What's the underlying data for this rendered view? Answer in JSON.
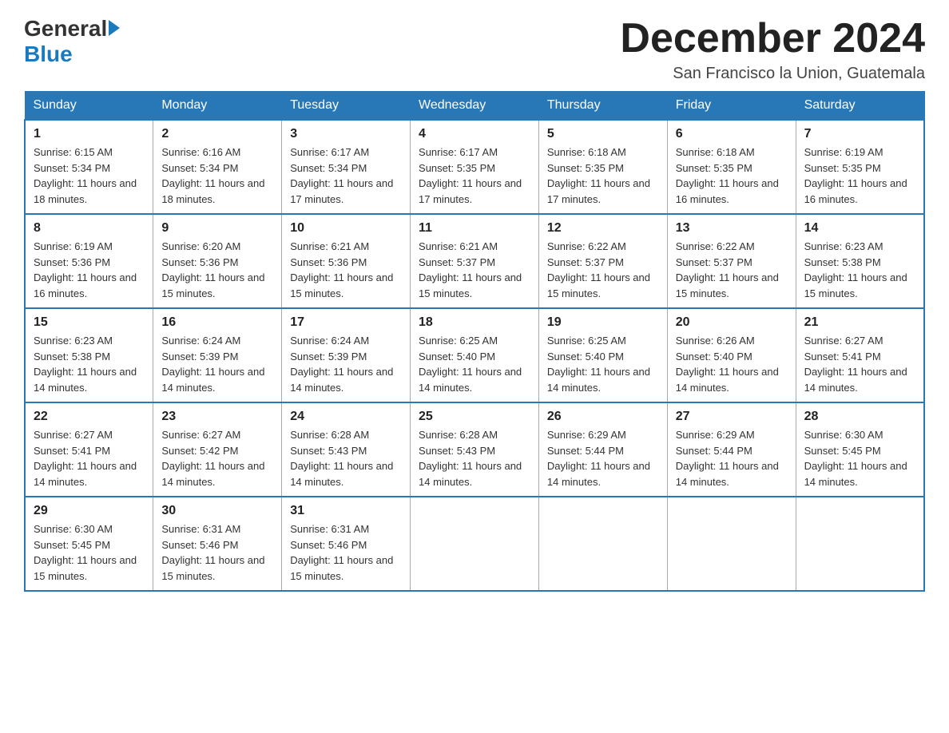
{
  "logo": {
    "general": "General",
    "blue": "Blue"
  },
  "title": "December 2024",
  "location": "San Francisco la Union, Guatemala",
  "weekdays": [
    "Sunday",
    "Monday",
    "Tuesday",
    "Wednesday",
    "Thursday",
    "Friday",
    "Saturday"
  ],
  "weeks": [
    [
      {
        "day": "1",
        "sunrise": "6:15 AM",
        "sunset": "5:34 PM",
        "daylight": "11 hours and 18 minutes."
      },
      {
        "day": "2",
        "sunrise": "6:16 AM",
        "sunset": "5:34 PM",
        "daylight": "11 hours and 18 minutes."
      },
      {
        "day": "3",
        "sunrise": "6:17 AM",
        "sunset": "5:34 PM",
        "daylight": "11 hours and 17 minutes."
      },
      {
        "day": "4",
        "sunrise": "6:17 AM",
        "sunset": "5:35 PM",
        "daylight": "11 hours and 17 minutes."
      },
      {
        "day": "5",
        "sunrise": "6:18 AM",
        "sunset": "5:35 PM",
        "daylight": "11 hours and 17 minutes."
      },
      {
        "day": "6",
        "sunrise": "6:18 AM",
        "sunset": "5:35 PM",
        "daylight": "11 hours and 16 minutes."
      },
      {
        "day": "7",
        "sunrise": "6:19 AM",
        "sunset": "5:35 PM",
        "daylight": "11 hours and 16 minutes."
      }
    ],
    [
      {
        "day": "8",
        "sunrise": "6:19 AM",
        "sunset": "5:36 PM",
        "daylight": "11 hours and 16 minutes."
      },
      {
        "day": "9",
        "sunrise": "6:20 AM",
        "sunset": "5:36 PM",
        "daylight": "11 hours and 15 minutes."
      },
      {
        "day": "10",
        "sunrise": "6:21 AM",
        "sunset": "5:36 PM",
        "daylight": "11 hours and 15 minutes."
      },
      {
        "day": "11",
        "sunrise": "6:21 AM",
        "sunset": "5:37 PM",
        "daylight": "11 hours and 15 minutes."
      },
      {
        "day": "12",
        "sunrise": "6:22 AM",
        "sunset": "5:37 PM",
        "daylight": "11 hours and 15 minutes."
      },
      {
        "day": "13",
        "sunrise": "6:22 AM",
        "sunset": "5:37 PM",
        "daylight": "11 hours and 15 minutes."
      },
      {
        "day": "14",
        "sunrise": "6:23 AM",
        "sunset": "5:38 PM",
        "daylight": "11 hours and 15 minutes."
      }
    ],
    [
      {
        "day": "15",
        "sunrise": "6:23 AM",
        "sunset": "5:38 PM",
        "daylight": "11 hours and 14 minutes."
      },
      {
        "day": "16",
        "sunrise": "6:24 AM",
        "sunset": "5:39 PM",
        "daylight": "11 hours and 14 minutes."
      },
      {
        "day": "17",
        "sunrise": "6:24 AM",
        "sunset": "5:39 PM",
        "daylight": "11 hours and 14 minutes."
      },
      {
        "day": "18",
        "sunrise": "6:25 AM",
        "sunset": "5:40 PM",
        "daylight": "11 hours and 14 minutes."
      },
      {
        "day": "19",
        "sunrise": "6:25 AM",
        "sunset": "5:40 PM",
        "daylight": "11 hours and 14 minutes."
      },
      {
        "day": "20",
        "sunrise": "6:26 AM",
        "sunset": "5:40 PM",
        "daylight": "11 hours and 14 minutes."
      },
      {
        "day": "21",
        "sunrise": "6:27 AM",
        "sunset": "5:41 PM",
        "daylight": "11 hours and 14 minutes."
      }
    ],
    [
      {
        "day": "22",
        "sunrise": "6:27 AM",
        "sunset": "5:41 PM",
        "daylight": "11 hours and 14 minutes."
      },
      {
        "day": "23",
        "sunrise": "6:27 AM",
        "sunset": "5:42 PM",
        "daylight": "11 hours and 14 minutes."
      },
      {
        "day": "24",
        "sunrise": "6:28 AM",
        "sunset": "5:43 PM",
        "daylight": "11 hours and 14 minutes."
      },
      {
        "day": "25",
        "sunrise": "6:28 AM",
        "sunset": "5:43 PM",
        "daylight": "11 hours and 14 minutes."
      },
      {
        "day": "26",
        "sunrise": "6:29 AM",
        "sunset": "5:44 PM",
        "daylight": "11 hours and 14 minutes."
      },
      {
        "day": "27",
        "sunrise": "6:29 AM",
        "sunset": "5:44 PM",
        "daylight": "11 hours and 14 minutes."
      },
      {
        "day": "28",
        "sunrise": "6:30 AM",
        "sunset": "5:45 PM",
        "daylight": "11 hours and 14 minutes."
      }
    ],
    [
      {
        "day": "29",
        "sunrise": "6:30 AM",
        "sunset": "5:45 PM",
        "daylight": "11 hours and 15 minutes."
      },
      {
        "day": "30",
        "sunrise": "6:31 AM",
        "sunset": "5:46 PM",
        "daylight": "11 hours and 15 minutes."
      },
      {
        "day": "31",
        "sunrise": "6:31 AM",
        "sunset": "5:46 PM",
        "daylight": "11 hours and 15 minutes."
      },
      null,
      null,
      null,
      null
    ]
  ]
}
